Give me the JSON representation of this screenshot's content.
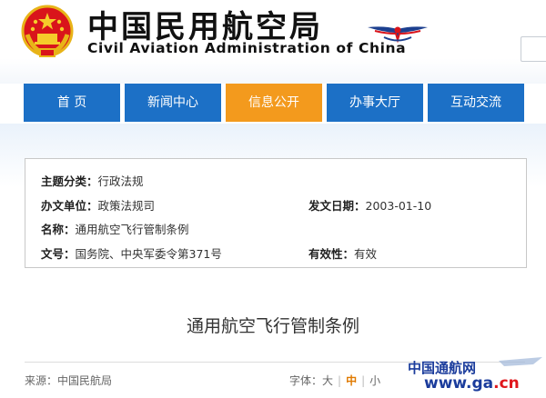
{
  "header": {
    "title_zh": "中国民用航空局",
    "title_en": "Civil Aviation Administration of China"
  },
  "nav": {
    "items": [
      {
        "label": "首 页",
        "active": false
      },
      {
        "label": "新闻中心",
        "active": false
      },
      {
        "label": "信息公开",
        "active": true
      },
      {
        "label": "办事大厅",
        "active": false
      },
      {
        "label": "互动交流",
        "active": false
      }
    ]
  },
  "info": {
    "category_label": "主题分类：",
    "category_value": "行政法规",
    "issuer_label": "办文单位：",
    "issuer_value": "政策法规司",
    "date_label": "发文日期：",
    "date_value": "2003-01-10",
    "name_label": "名称：",
    "name_value": "通用航空飞行管制条例",
    "docno_label": "文号：",
    "docno_value": "国务院、中央军委令第371号",
    "validity_label": "有效性：",
    "validity_value": "有效"
  },
  "document": {
    "title": "通用航空飞行管制条例",
    "source": "来源：中国民航局",
    "font_label": "字体：",
    "font_large": "大",
    "font_medium": "中",
    "font_small": "小"
  },
  "watermark": {
    "text": "中国通航网",
    "url_main": "www.ga",
    "url_suffix": ".cn"
  },
  "colors": {
    "nav_blue": "#1c70c6",
    "nav_orange": "#f39a1d",
    "accent": "#e07a00"
  }
}
